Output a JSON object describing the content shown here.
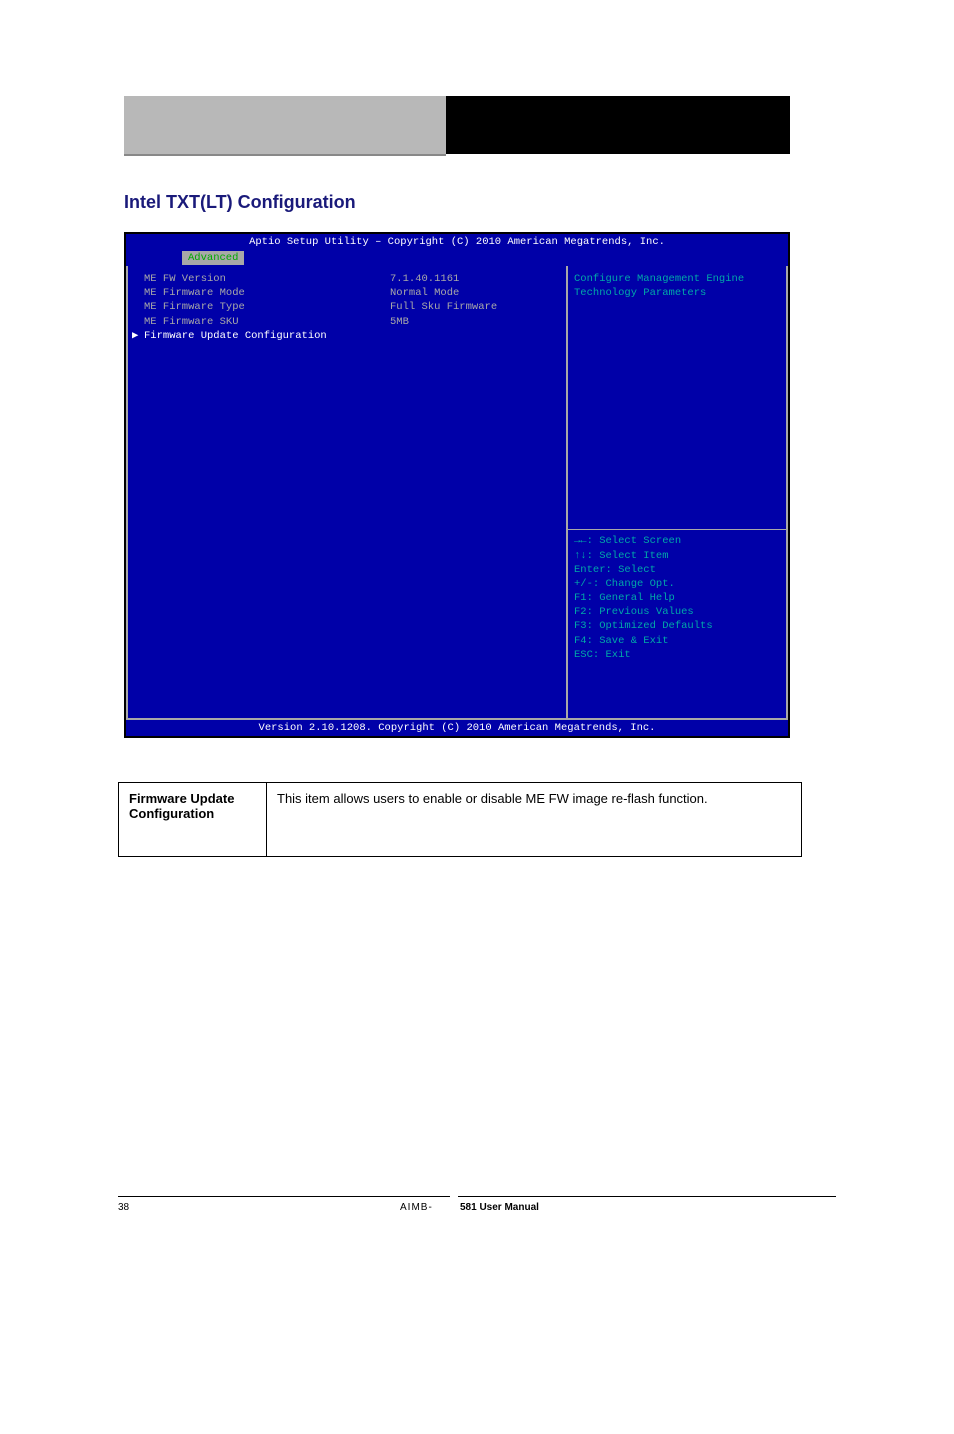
{
  "section_title": "Intel TXT(LT) Configuration",
  "bios": {
    "top_bar": "Aptio Setup Utility – Copyright (C) 2010 American Megatrends, Inc.",
    "tab": "Advanced",
    "rows": [
      {
        "label": "ME FW Version",
        "value": "7.1.40.1161"
      },
      {
        "label": "ME Firmware Mode",
        "value": "Normal Mode"
      },
      {
        "label": "ME Firmware Type",
        "value": "Full Sku Firmware"
      },
      {
        "label": "ME Firmware SKU",
        "value": "5MB"
      }
    ],
    "submenu": "Firmware Update Configuration",
    "help_text_1": "Configure Management Engine",
    "help_text_2": "Technology Parameters",
    "keys": [
      "→←: Select Screen",
      "↑↓: Select Item",
      "Enter: Select",
      "+/-: Change Opt.",
      "F1: General Help",
      "F2: Previous Values",
      "F3: Optimized Defaults",
      "F4: Save & Exit",
      "ESC: Exit"
    ],
    "bottom_bar": "Version 2.10.1208. Copyright (C) 2010 American Megatrends, Inc."
  },
  "desc": {
    "col1": "Firmware Update Configuration",
    "col2": "This item allows users to enable or disable ME FW image re-flash function."
  },
  "footer": {
    "page": "38",
    "model_left": "AIMB-",
    "model_right": "581 User Manual"
  }
}
